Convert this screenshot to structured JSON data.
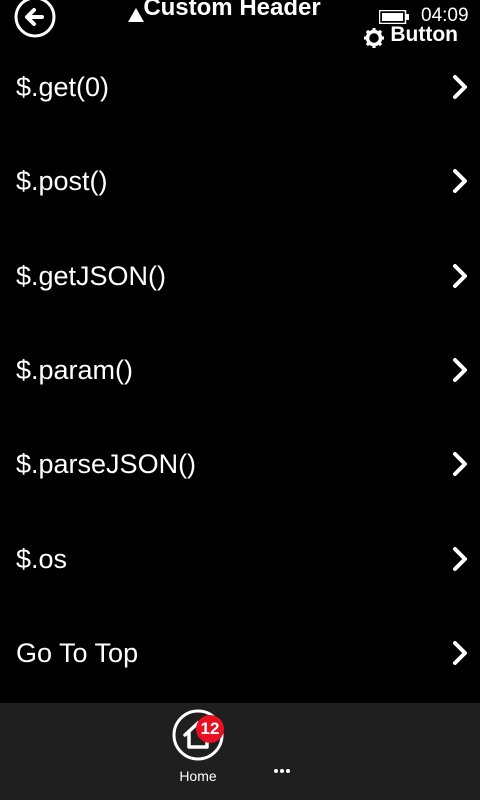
{
  "status_bar": {
    "time": "04:09",
    "battery_level": 0.85
  },
  "header": {
    "title": "Custom Header",
    "button_label": "Button",
    "back_icon": "arrow-left-circle-icon",
    "button_icon": "gear-icon"
  },
  "list": {
    "items": [
      {
        "label": "$.get(0)"
      },
      {
        "label": "$.post()"
      },
      {
        "label": "$.getJSON()"
      },
      {
        "label": "$.param()"
      },
      {
        "label": "$.parseJSON()"
      },
      {
        "label": "$.os"
      },
      {
        "label": "Go To Top"
      }
    ]
  },
  "footer": {
    "home_label": "Home",
    "home_badge": "12",
    "more_label": "•••"
  },
  "colors": {
    "background": "#000000",
    "footer": "#1f1f1f",
    "badge": "#e81123",
    "text": "#ffffff"
  }
}
